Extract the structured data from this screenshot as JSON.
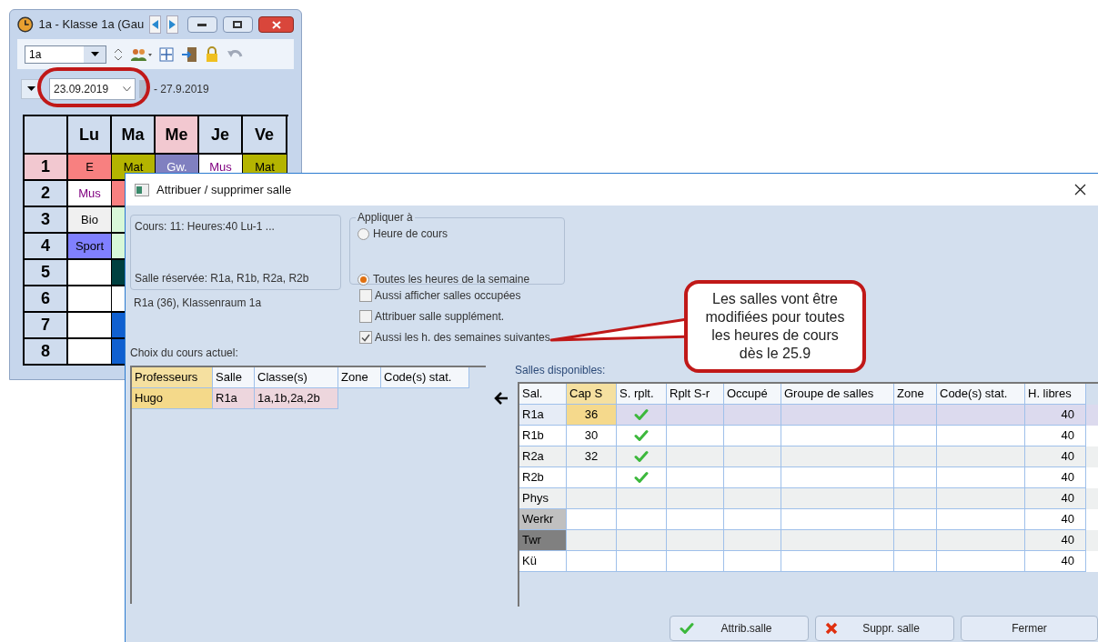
{
  "timetable_window": {
    "title": "1a - Klasse 1a (Gau",
    "class_field": {
      "value": "1a"
    },
    "date_field": {
      "value": "23.09.2019"
    },
    "date_end": "- 27.9.2019",
    "days": [
      {
        "label": "Lu",
        "selected": false
      },
      {
        "label": "Ma",
        "selected": false
      },
      {
        "label": "Me",
        "selected": true
      },
      {
        "label": "Je",
        "selected": false
      },
      {
        "label": "Ve",
        "selected": false
      }
    ],
    "periods": [
      {
        "label": "1",
        "selected": true,
        "lessons": [
          {
            "text": "E",
            "color": "#f88080"
          },
          {
            "text": "Mat",
            "color": "#b4b400"
          },
          {
            "text": "Gw.",
            "color": "#8080c0"
          },
          {
            "text": "Mus",
            "color": "#ffffff"
          },
          {
            "text": "Mat",
            "color": "#b4b400"
          }
        ]
      },
      {
        "label": "2",
        "selected": false,
        "lessons": [
          {
            "text": "Mus",
            "color": "#ffffff"
          },
          {
            "color": "#f88080"
          }
        ]
      },
      {
        "label": "3",
        "selected": false,
        "lessons": [
          {
            "text": "Bio",
            "color": "#f0f0f0"
          },
          {
            "color": "#d8f8d8"
          }
        ]
      },
      {
        "label": "4",
        "selected": false,
        "lessons": [
          {
            "text": "Sport",
            "color": "#8080ff"
          },
          {
            "color": "#d8f8d8"
          }
        ]
      },
      {
        "label": "5",
        "selected": false,
        "lessons": [
          {
            "color": "#ffffff"
          },
          {
            "color": "#004040"
          }
        ]
      },
      {
        "label": "6",
        "selected": false,
        "lessons": [
          {
            "color": "#ffffff"
          },
          {
            "color": "#ffffff"
          }
        ]
      },
      {
        "label": "7",
        "selected": false,
        "lessons": [
          {
            "color": "#ffffff"
          },
          {
            "color": "#1060d0"
          }
        ]
      },
      {
        "label": "8",
        "selected": false,
        "lessons": [
          {
            "color": "#ffffff"
          },
          {
            "color": "#1060d0"
          }
        ]
      }
    ]
  },
  "dialog": {
    "title": "Attribuer / supprimer salle",
    "info_lines": [
      "Cours: 11: Heures:40 Lu-1 ...",
      "Salle réservée: R1a, R1b, R2a, R2b"
    ],
    "room_info": "R1a (36), Klassenraum 1a",
    "apply_group": {
      "title": "Appliquer à",
      "options": [
        {
          "label": "Heure de cours",
          "selected": false
        },
        {
          "label": "Toutes les heures de la semaine",
          "selected": true
        }
      ]
    },
    "checkboxes": [
      {
        "label": "Aussi afficher salles occupées",
        "checked": false
      },
      {
        "label": "Attribuer salle supplément.",
        "checked": false
      },
      {
        "label": "Aussi les h. des semaines suivantes",
        "checked": true
      }
    ],
    "current_label": "Choix du cours actuel:",
    "current_table": {
      "columns": [
        "Professeurs",
        "Salle",
        "Classe(s)",
        "Zone",
        "Code(s) stat."
      ],
      "rows": [
        {
          "cells": [
            "Hugo",
            "R1a",
            "1a,1b,2a,2b"
          ]
        }
      ]
    },
    "rooms_label": "Salles disponibles:",
    "rooms_table": {
      "columns": [
        "Sal.",
        "Cap S",
        "S. rplt.",
        "Rplt S-r",
        "Occupé",
        "Groupe de salles",
        "Zone",
        "Code(s) stat.",
        "H. libres"
      ],
      "rows": [
        {
          "room": "R1a",
          "capacity": "36",
          "replaced": true,
          "free_hours": "40",
          "selected": true,
          "color": "#e6ecf6"
        },
        {
          "room": "R1b",
          "capacity": "30",
          "replaced": true,
          "free_hours": "40",
          "selected": false,
          "color": "#ffffff"
        },
        {
          "room": "R2a",
          "capacity": "32",
          "replaced": true,
          "free_hours": "40",
          "selected": false,
          "color": "#eef0f0"
        },
        {
          "room": "R2b",
          "replaced": true,
          "free_hours": "40",
          "selected": false,
          "color": "#ffffff"
        },
        {
          "room": "Phys",
          "replaced": false,
          "free_hours": "40",
          "selected": false,
          "color": "#eef0f0"
        },
        {
          "room": "Werkr",
          "replaced": false,
          "free_hours": "40",
          "selected": false,
          "color": "#c0c0c0"
        },
        {
          "room": "Twr",
          "replaced": false,
          "free_hours": "40",
          "selected": false,
          "color": "#808080"
        },
        {
          "room": "Kü",
          "replaced": false,
          "free_hours": "40",
          "selected": false,
          "color": "#ffffff"
        }
      ]
    },
    "buttons": [
      {
        "label": "Attrib.salle",
        "kind": "assign"
      },
      {
        "label": "Suppr. salle",
        "kind": "remove"
      },
      {
        "label": "Fermer",
        "kind": "plain"
      }
    ]
  },
  "callout": {
    "text": "Les salles vont être modifiées pour toutes les heures de cours dès le 25.9"
  }
}
